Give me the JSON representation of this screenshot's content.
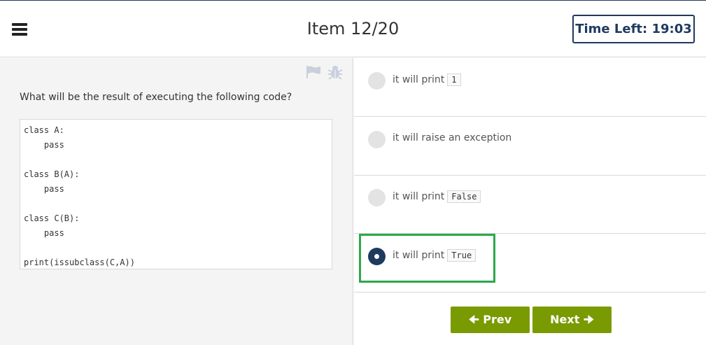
{
  "header": {
    "item_title": "Item 12/20",
    "timer": "Time Left: 19:03"
  },
  "question": {
    "text": "What will be the result of executing the following code?",
    "code": "class A:\n    pass\n\nclass B(A):\n    pass\n\nclass C(B):\n    pass\n\nprint(issubclass(C,A))"
  },
  "options": [
    {
      "text": "it will print",
      "code": "1",
      "selected": false
    },
    {
      "text": "it will raise an exception",
      "code": "",
      "selected": false
    },
    {
      "text": "it will print",
      "code": "False",
      "selected": false
    },
    {
      "text": "it will print",
      "code": "True",
      "selected": true
    }
  ],
  "nav": {
    "prev_label": "Prev",
    "next_label": "Next"
  },
  "icons": {
    "menu": "hamburger-icon",
    "flag": "flag-icon",
    "bug": "bug-icon",
    "prev_arrow": "arrow-left-icon",
    "next_arrow": "arrow-right-icon"
  },
  "colors": {
    "primary": "#1f3a5f",
    "nav_button": "#7a9a01",
    "highlight": "#2ea84a"
  }
}
